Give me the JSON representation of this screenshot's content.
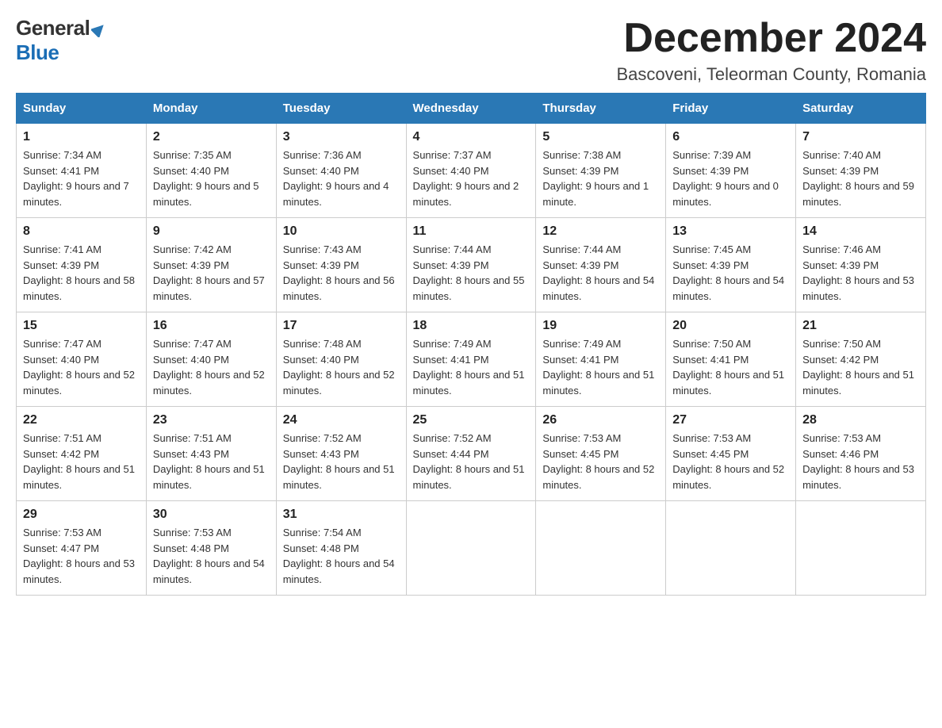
{
  "logo": {
    "general": "General",
    "blue": "Blue"
  },
  "title": "December 2024",
  "location": "Bascoveni, Teleorman County, Romania",
  "days_of_week": [
    "Sunday",
    "Monday",
    "Tuesday",
    "Wednesday",
    "Thursday",
    "Friday",
    "Saturday"
  ],
  "weeks": [
    [
      {
        "day": "1",
        "sunrise": "7:34 AM",
        "sunset": "4:41 PM",
        "daylight": "9 hours and 7 minutes."
      },
      {
        "day": "2",
        "sunrise": "7:35 AM",
        "sunset": "4:40 PM",
        "daylight": "9 hours and 5 minutes."
      },
      {
        "day": "3",
        "sunrise": "7:36 AM",
        "sunset": "4:40 PM",
        "daylight": "9 hours and 4 minutes."
      },
      {
        "day": "4",
        "sunrise": "7:37 AM",
        "sunset": "4:40 PM",
        "daylight": "9 hours and 2 minutes."
      },
      {
        "day": "5",
        "sunrise": "7:38 AM",
        "sunset": "4:39 PM",
        "daylight": "9 hours and 1 minute."
      },
      {
        "day": "6",
        "sunrise": "7:39 AM",
        "sunset": "4:39 PM",
        "daylight": "9 hours and 0 minutes."
      },
      {
        "day": "7",
        "sunrise": "7:40 AM",
        "sunset": "4:39 PM",
        "daylight": "8 hours and 59 minutes."
      }
    ],
    [
      {
        "day": "8",
        "sunrise": "7:41 AM",
        "sunset": "4:39 PM",
        "daylight": "8 hours and 58 minutes."
      },
      {
        "day": "9",
        "sunrise": "7:42 AM",
        "sunset": "4:39 PM",
        "daylight": "8 hours and 57 minutes."
      },
      {
        "day": "10",
        "sunrise": "7:43 AM",
        "sunset": "4:39 PM",
        "daylight": "8 hours and 56 minutes."
      },
      {
        "day": "11",
        "sunrise": "7:44 AM",
        "sunset": "4:39 PM",
        "daylight": "8 hours and 55 minutes."
      },
      {
        "day": "12",
        "sunrise": "7:44 AM",
        "sunset": "4:39 PM",
        "daylight": "8 hours and 54 minutes."
      },
      {
        "day": "13",
        "sunrise": "7:45 AM",
        "sunset": "4:39 PM",
        "daylight": "8 hours and 54 minutes."
      },
      {
        "day": "14",
        "sunrise": "7:46 AM",
        "sunset": "4:39 PM",
        "daylight": "8 hours and 53 minutes."
      }
    ],
    [
      {
        "day": "15",
        "sunrise": "7:47 AM",
        "sunset": "4:40 PM",
        "daylight": "8 hours and 52 minutes."
      },
      {
        "day": "16",
        "sunrise": "7:47 AM",
        "sunset": "4:40 PM",
        "daylight": "8 hours and 52 minutes."
      },
      {
        "day": "17",
        "sunrise": "7:48 AM",
        "sunset": "4:40 PM",
        "daylight": "8 hours and 52 minutes."
      },
      {
        "day": "18",
        "sunrise": "7:49 AM",
        "sunset": "4:41 PM",
        "daylight": "8 hours and 51 minutes."
      },
      {
        "day": "19",
        "sunrise": "7:49 AM",
        "sunset": "4:41 PM",
        "daylight": "8 hours and 51 minutes."
      },
      {
        "day": "20",
        "sunrise": "7:50 AM",
        "sunset": "4:41 PM",
        "daylight": "8 hours and 51 minutes."
      },
      {
        "day": "21",
        "sunrise": "7:50 AM",
        "sunset": "4:42 PM",
        "daylight": "8 hours and 51 minutes."
      }
    ],
    [
      {
        "day": "22",
        "sunrise": "7:51 AM",
        "sunset": "4:42 PM",
        "daylight": "8 hours and 51 minutes."
      },
      {
        "day": "23",
        "sunrise": "7:51 AM",
        "sunset": "4:43 PM",
        "daylight": "8 hours and 51 minutes."
      },
      {
        "day": "24",
        "sunrise": "7:52 AM",
        "sunset": "4:43 PM",
        "daylight": "8 hours and 51 minutes."
      },
      {
        "day": "25",
        "sunrise": "7:52 AM",
        "sunset": "4:44 PM",
        "daylight": "8 hours and 51 minutes."
      },
      {
        "day": "26",
        "sunrise": "7:53 AM",
        "sunset": "4:45 PM",
        "daylight": "8 hours and 52 minutes."
      },
      {
        "day": "27",
        "sunrise": "7:53 AM",
        "sunset": "4:45 PM",
        "daylight": "8 hours and 52 minutes."
      },
      {
        "day": "28",
        "sunrise": "7:53 AM",
        "sunset": "4:46 PM",
        "daylight": "8 hours and 53 minutes."
      }
    ],
    [
      {
        "day": "29",
        "sunrise": "7:53 AM",
        "sunset": "4:47 PM",
        "daylight": "8 hours and 53 minutes."
      },
      {
        "day": "30",
        "sunrise": "7:53 AM",
        "sunset": "4:48 PM",
        "daylight": "8 hours and 54 minutes."
      },
      {
        "day": "31",
        "sunrise": "7:54 AM",
        "sunset": "4:48 PM",
        "daylight": "8 hours and 54 minutes."
      },
      null,
      null,
      null,
      null
    ]
  ],
  "labels": {
    "sunrise": "Sunrise:",
    "sunset": "Sunset:",
    "daylight": "Daylight:"
  }
}
